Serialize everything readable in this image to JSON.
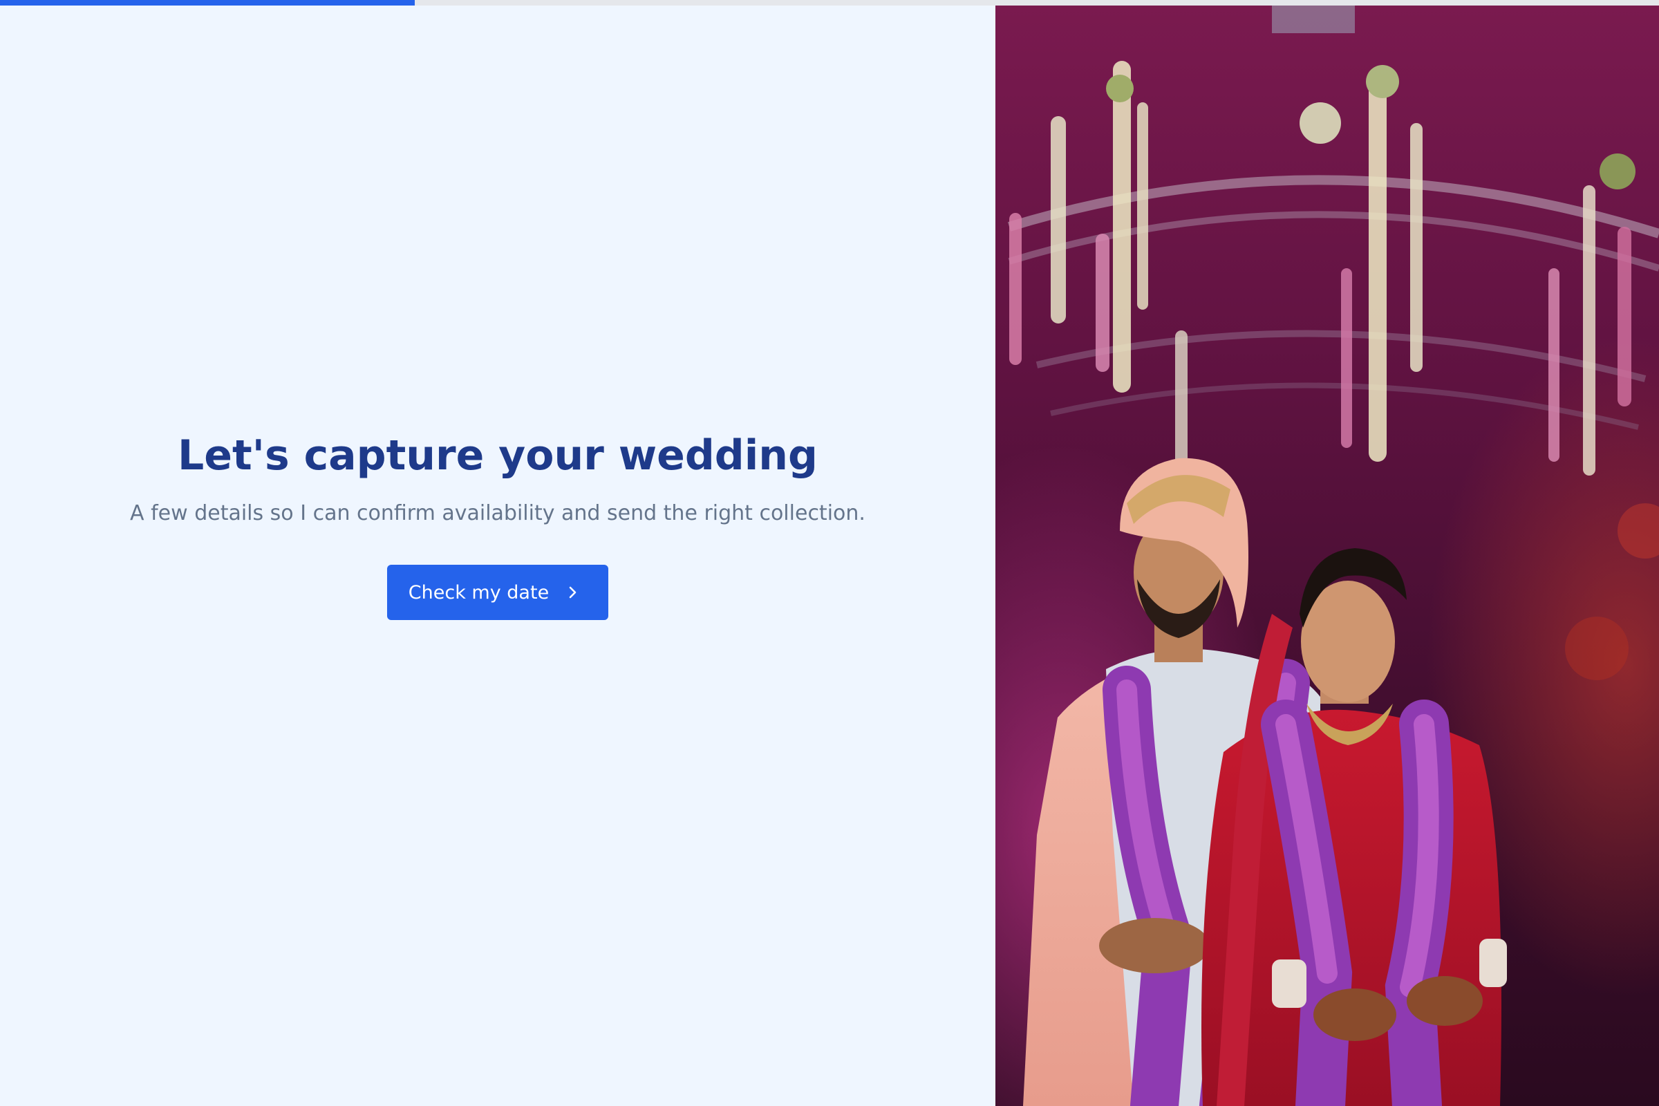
{
  "progress": {
    "value_percent": 25,
    "color": "#2563eb",
    "track_color": "#e5e7eb"
  },
  "intro": {
    "title": "Let's capture your wedding",
    "subtitle": "A few details so I can confirm availability and send the right collection.",
    "cta_label": "Check my date",
    "cta_icon": "chevron-right-icon"
  },
  "photo": {
    "subject": "wedding-couple-photo"
  },
  "colors": {
    "background": "#eff6ff",
    "heading": "#1e3a8a",
    "body_text": "#64748b",
    "accent": "#2563eb"
  }
}
